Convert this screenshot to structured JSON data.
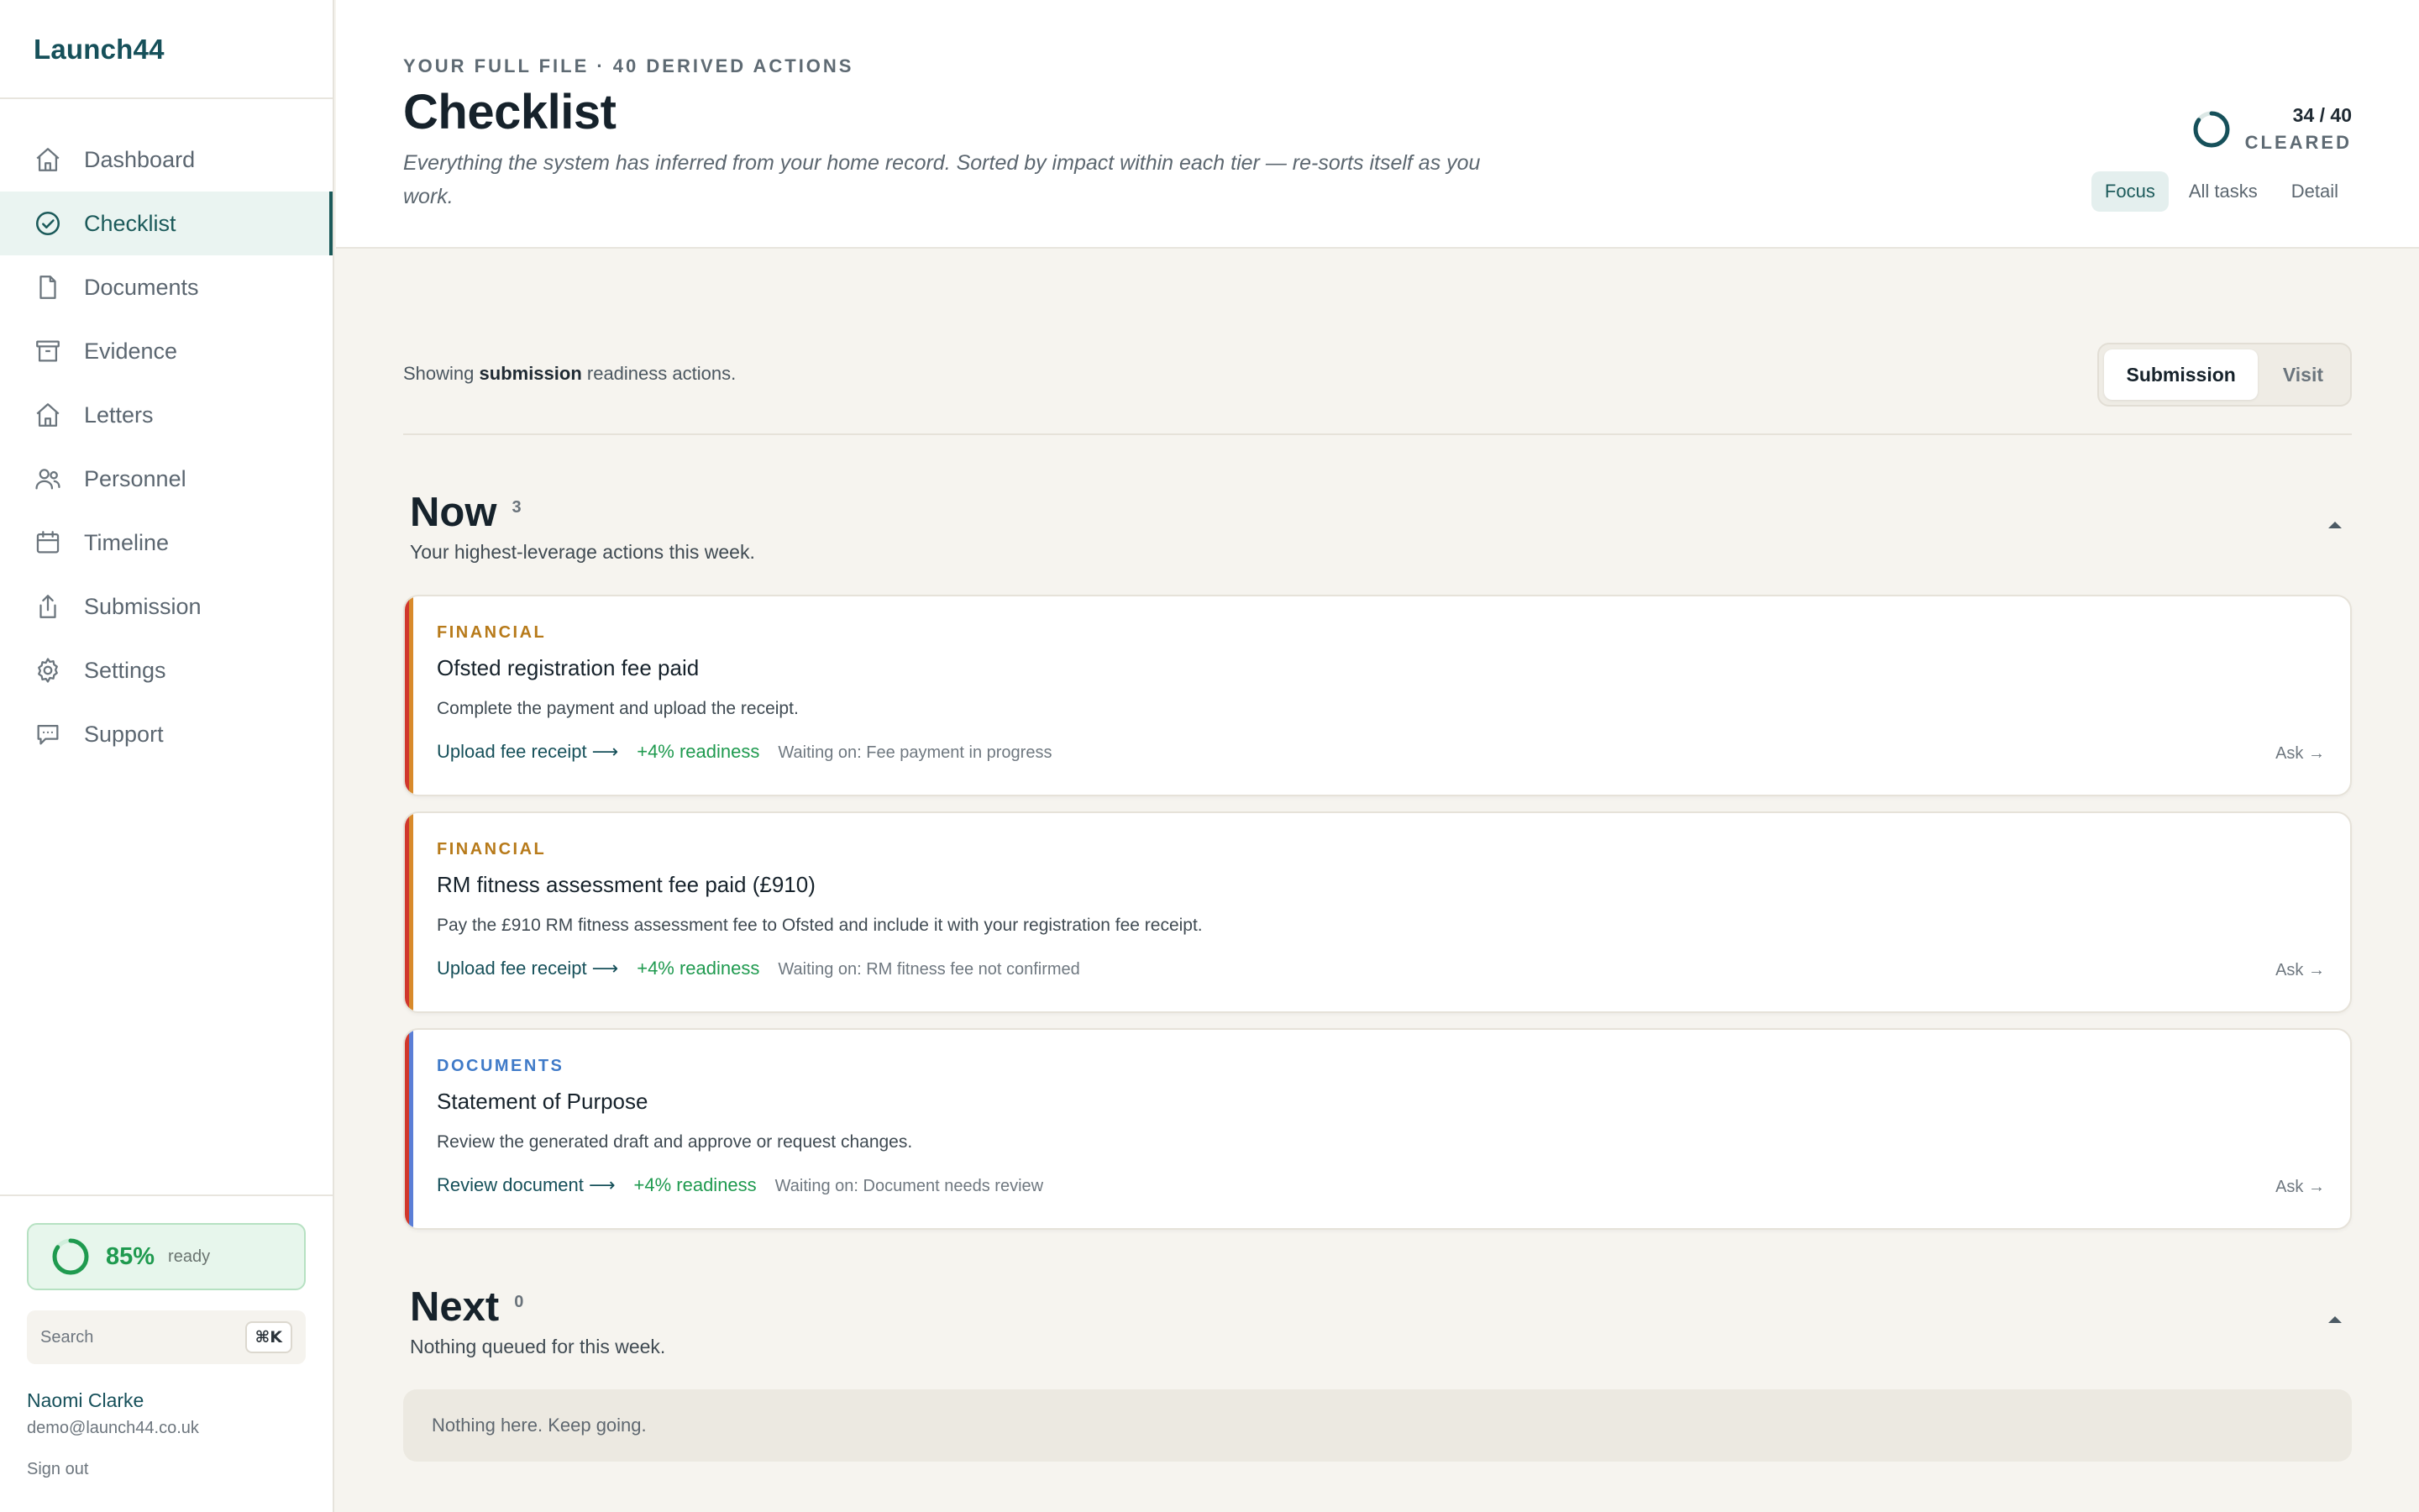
{
  "app": {
    "name": "Launch44"
  },
  "sidebar": {
    "items": [
      {
        "label": "Dashboard",
        "icon": "home-icon",
        "active": false
      },
      {
        "label": "Checklist",
        "icon": "check-circle-icon",
        "active": true
      },
      {
        "label": "Documents",
        "icon": "file-icon",
        "active": false
      },
      {
        "label": "Evidence",
        "icon": "archive-icon",
        "active": false
      },
      {
        "label": "Letters",
        "icon": "home-icon",
        "active": false
      },
      {
        "label": "Personnel",
        "icon": "users-icon",
        "active": false
      },
      {
        "label": "Timeline",
        "icon": "calendar-icon",
        "active": false
      },
      {
        "label": "Submission",
        "icon": "upload-icon",
        "active": false
      },
      {
        "label": "Settings",
        "icon": "gear-icon",
        "active": false
      },
      {
        "label": "Support",
        "icon": "chat-icon",
        "active": false
      }
    ],
    "readiness": {
      "percent_text": "85%",
      "percent": 85,
      "label": "ready"
    },
    "search": {
      "placeholder": "Search",
      "shortcut": "⌘K"
    },
    "user": {
      "name": "Naomi Clarke",
      "email": "demo@launch44.co.uk",
      "sign_out": "Sign out"
    }
  },
  "header": {
    "eyebrow": "YOUR FULL FILE · 40 DERIVED ACTIONS",
    "title": "Checklist",
    "subtitle": "Everything the system has inferred from your home record. Sorted by impact within each tier — re-sorts itself as you work.",
    "progress": {
      "count_text": "34 / 40",
      "done": 34,
      "total": 40,
      "label": "CLEARED"
    },
    "view_tabs": [
      {
        "label": "Focus",
        "active": true
      },
      {
        "label": "All tasks",
        "active": false
      },
      {
        "label": "Detail",
        "active": false
      }
    ]
  },
  "filter": {
    "prefix": "Showing ",
    "emphasis": "submission",
    "suffix": " readiness actions.",
    "segments": [
      {
        "label": "Submission",
        "active": true
      },
      {
        "label": "Visit",
        "active": false
      }
    ]
  },
  "groups": {
    "now": {
      "title": "Now",
      "count": "3",
      "subtitle": "Your highest-leverage actions this week.",
      "cards": [
        {
          "category": "FINANCIAL",
          "title": "Ofsted registration fee paid",
          "description": "Complete the payment and upload the receipt.",
          "action": "Upload fee receipt ⟶",
          "impact": "+4% readiness",
          "waiting": "Waiting on: Fee payment in progress",
          "ask": "Ask →"
        },
        {
          "category": "FINANCIAL",
          "title": "RM fitness assessment fee paid (£910)",
          "description": "Pay the £910 RM fitness assessment fee to Ofsted and include it with your registration fee receipt.",
          "action": "Upload fee receipt ⟶",
          "impact": "+4% readiness",
          "waiting": "Waiting on: RM fitness fee not confirmed",
          "ask": "Ask →"
        },
        {
          "category": "DOCUMENTS",
          "title": "Statement of Purpose",
          "description": "Review the generated draft and approve or request changes.",
          "action": "Review document ⟶",
          "impact": "+4% readiness",
          "waiting": "Waiting on: Document needs review",
          "ask": "Ask →"
        }
      ]
    },
    "next": {
      "title": "Next",
      "count": "0",
      "subtitle": "Nothing queued for this week.",
      "empty": "Nothing here. Keep going."
    }
  },
  "colors": {
    "brand": "#16505a",
    "accent_green": "#1f9a4f",
    "financial": "#b77a1a",
    "documents": "#3f7ac8",
    "urgent_red": "#d0372c"
  }
}
